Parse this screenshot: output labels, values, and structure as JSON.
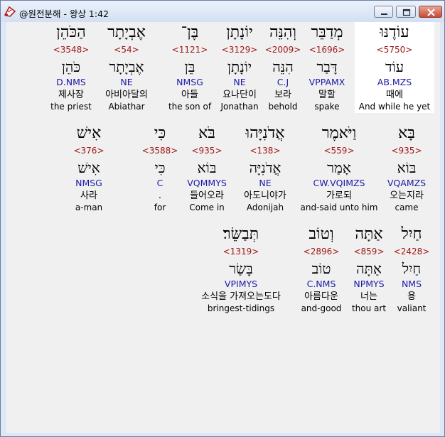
{
  "window": {
    "title": "@원전분해 - 왕상 1:42"
  },
  "colors": {
    "strong": "#a01818",
    "morph": "#1a1aa8",
    "close_button": "#c84a35"
  },
  "rows": [
    [
      {
        "hebrew": "עוֹדֶנּוּ",
        "strong": "<5750>",
        "lemma": "עוֹד",
        "morph": "AB.MZS",
        "korean": "때에",
        "english": "And while he yet",
        "selected": true
      },
      {
        "hebrew": "מְדַבֵּר",
        "strong": "<1696>",
        "lemma": "דָּבַר",
        "morph": "VPPAMX",
        "korean": "말할",
        "english": "spake"
      },
      {
        "hebrew": "וְהִנֵּה",
        "strong": "<2009>",
        "lemma": "הִנֵּה",
        "morph": "C.J",
        "korean": "보라",
        "english": "behold"
      },
      {
        "hebrew": "יוֹנָתָן",
        "strong": "<3129>",
        "lemma": "יוֹנָתָן",
        "morph": "NE",
        "korean": "요나단이",
        "english": "Jonathan"
      },
      {
        "hebrew": "בֶּן־",
        "strong": "<1121>",
        "lemma": "בֵּן",
        "morph": "NMSG",
        "korean": "아들",
        "english": "the son of"
      },
      {
        "hebrew": "אֶבְיָתָר",
        "strong": "<54>",
        "lemma": "אֶבְיָתָר",
        "morph": "NE",
        "korean": "아비아달의",
        "english": "Abiathar"
      },
      {
        "hebrew": "הַכֹּהֵן",
        "strong": "<3548>",
        "lemma": "כֹּהֵן",
        "morph": "D.NMS",
        "korean": "제사장",
        "english": "the priest"
      }
    ],
    [
      {
        "hebrew": "בָּא",
        "strong": "<935>",
        "lemma": "בּוֹא",
        "morph": "VQAMZS",
        "korean": "오는지라",
        "english": "came"
      },
      {
        "hebrew": "וַיֹּאמֶר",
        "strong": "<559>",
        "lemma": "אָמַר",
        "morph": "CW.VQIMZS",
        "korean": "가로되",
        "english": "and-said unto him"
      },
      {
        "hebrew": "אֲדֹנִיָּהוּ",
        "strong": "<138>",
        "lemma": "אֲדֹנִיָּה",
        "morph": "NE",
        "korean": "아도니야가",
        "english": "Adonijah"
      },
      {
        "hebrew": "בֹּא",
        "strong": "<935>",
        "lemma": "בּוֹא",
        "morph": "VQMMYS",
        "korean": "들어오라",
        "english": "Come in"
      },
      {
        "hebrew": "כִּי",
        "strong": "<3588>",
        "lemma": "כִּי",
        "morph": "C",
        "korean": ".",
        "english": "for"
      },
      {
        "hebrew": "אִישׁ",
        "strong": "<376>",
        "lemma": "אִישׁ",
        "morph": "NMSG",
        "korean": "사라",
        "english": "a-man"
      }
    ],
    [
      {
        "hebrew": "חַיִל",
        "strong": "<2428>",
        "lemma": "חַיִל",
        "morph": "NMS",
        "korean": "용",
        "english": "valiant"
      },
      {
        "hebrew": "אַתָּה",
        "strong": "<859>",
        "lemma": "אַתָּה",
        "morph": "NPMYS",
        "korean": "너는",
        "english": "thou art"
      },
      {
        "hebrew": "וְטוֹב",
        "strong": "<2896>",
        "lemma": "טוֹב",
        "morph": "C.NMS",
        "korean": "아름다운",
        "english": "and-good"
      },
      {
        "hebrew": "תְּבַשֵּׂר׃",
        "strong": "<1319>",
        "lemma": "בָּשַׂר",
        "morph": "VPIMYS",
        "korean": "소식을 가져오는도다",
        "english": "bringest-tidings"
      }
    ]
  ]
}
